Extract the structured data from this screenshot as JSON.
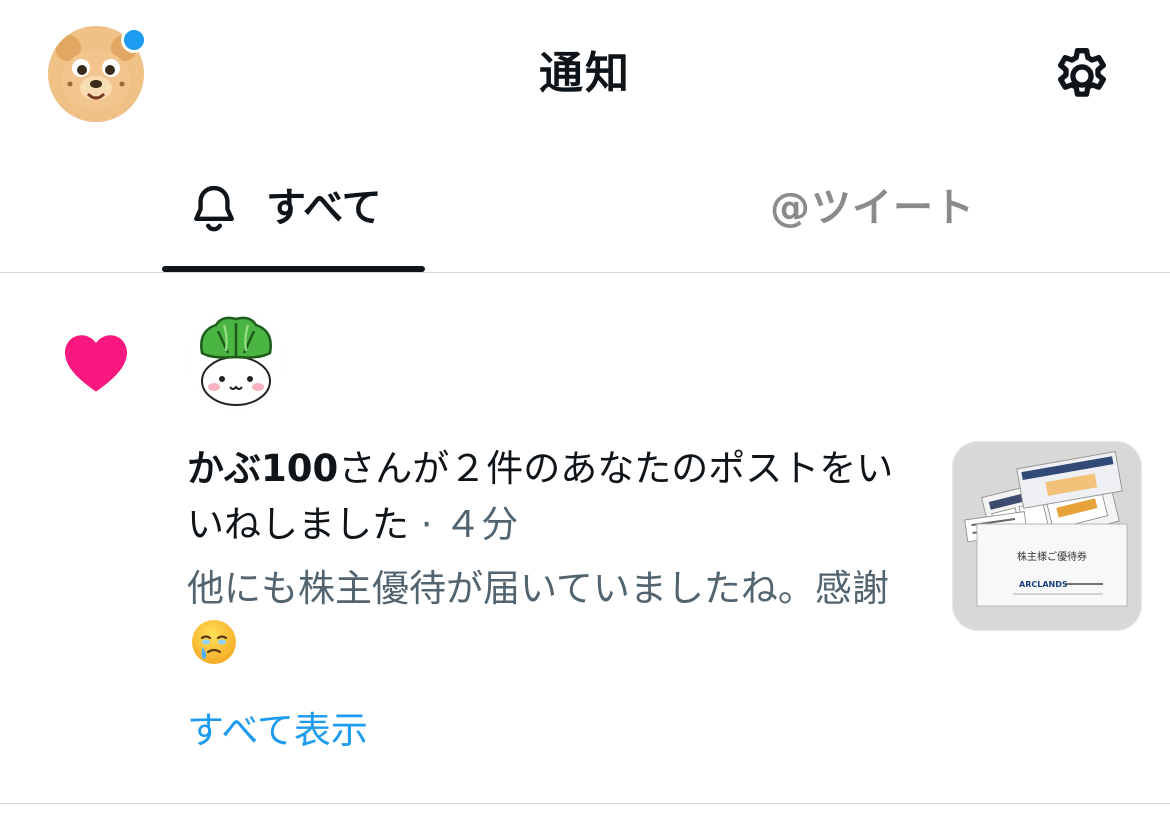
{
  "header": {
    "title": "通知",
    "avatar_icon": "bear-avatar-icon",
    "settings_icon": "gear-icon",
    "unread_dot_color": "#1d9bf0"
  },
  "tabs": [
    {
      "label": "すべて",
      "icon": "bell-icon",
      "selected": true
    },
    {
      "label": "@ツイート",
      "selected": false
    }
  ],
  "notification": {
    "type_icon": "heart-icon",
    "type_icon_color": "#f91880",
    "actor_avatar_icon": "turnip-avatar-icon",
    "actor": "かぶ100",
    "action": "さんが２件のあなたのポストをいいねしました",
    "time": " · ４分",
    "post_text": "他にも株主優待が届いていましたね。感謝",
    "post_emoji_icon": "face-holding-back-tears-icon",
    "show_all_label": "すべて表示",
    "thumbnail_text": "株主様ご優待券",
    "thumbnail_brand": "ARCLANDS"
  },
  "colors": {
    "link": "#1d9bf0",
    "secondary_text": "#536471",
    "primary_text": "#0f1419"
  }
}
